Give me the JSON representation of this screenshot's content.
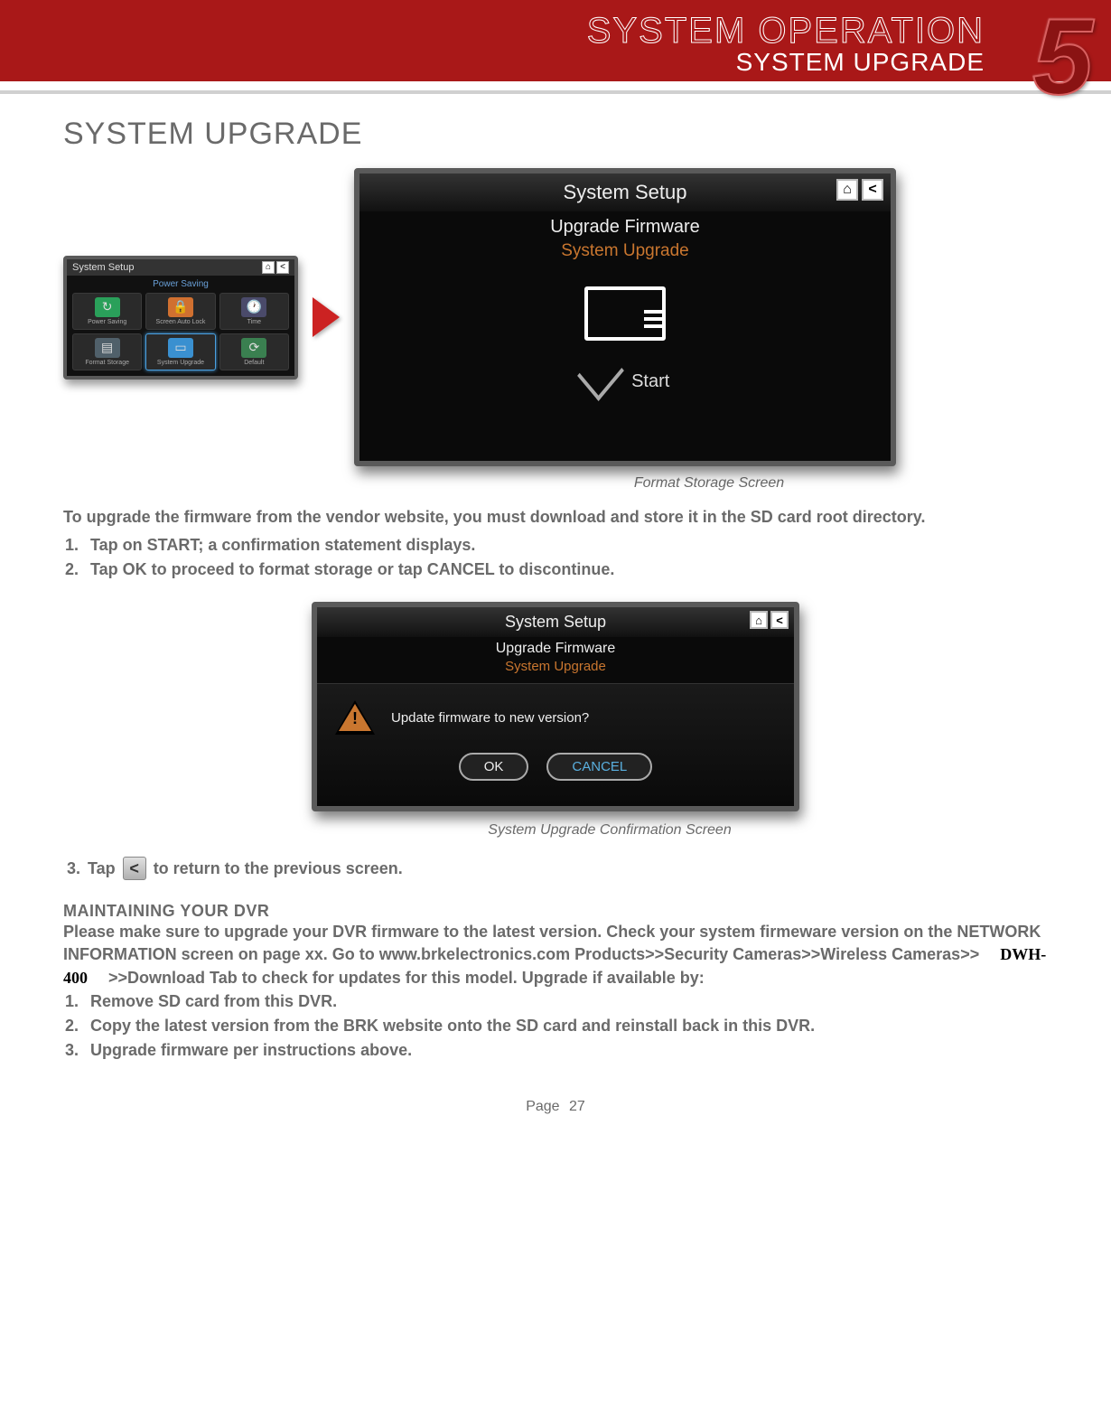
{
  "header": {
    "title_outline": "SYSTEM OPERATION",
    "subtitle": "SYSTEM UPGRADE",
    "chapter_number": "5"
  },
  "page_title": "SYSTEM UPGRADE",
  "thumb": {
    "title": "System Setup",
    "subtitle": "Power Saving",
    "items": [
      {
        "label": "Power Saving",
        "color": "#2aa05a"
      },
      {
        "label": "Screen Auto Lock",
        "color": "#d07030"
      },
      {
        "label": "Time",
        "color": "#9090b0"
      },
      {
        "label": "Format Storage",
        "color": "#8090a0"
      },
      {
        "label": "System Upgrade",
        "color": "#4aa0e0"
      },
      {
        "label": "Default",
        "color": "#60b080"
      }
    ]
  },
  "bigshot": {
    "title": "System Setup",
    "sub": "Upgrade Firmware",
    "sub2": "System Upgrade",
    "start": "Start"
  },
  "caption1": "Format Storage Screen",
  "intro": "To upgrade the firmware from the vendor website, you must download and store it in the SD card root directory.",
  "steps_a": [
    "Tap on START; a confirmation statement displays.",
    "Tap OK to proceed to format storage or tap CANCEL to discontinue."
  ],
  "midshot": {
    "title": "System Setup",
    "sub": "Upgrade Firmware",
    "sub2": "System Upgrade",
    "question": "Update firmware to new version?",
    "ok": "OK",
    "cancel": "CANCEL"
  },
  "caption2": "System Upgrade Confirmation Screen",
  "step3_pre": "Tap",
  "step3_post": "to return to the previous screen.",
  "maint_heading": "MAINTAINING YOUR DVR",
  "maint_pre": "Please make sure to upgrade your DVR firmware to the latest version. Check your system firmeware version on the NETWORK INFORMATION screen on page xx. Go to www.brkelectronics.com Products>>Security Cameras>>Wireless Cameras>>",
  "model": "DWH-400",
  "maint_post": ">>Download Tab to check for updates for this model. Upgrade if available by:",
  "steps_b": [
    "Remove SD card from this DVR.",
    "Copy the latest version from the BRK website onto the SD card and reinstall back in this DVR.",
    "Upgrade firmware per instructions above."
  ],
  "footer": {
    "label": "Page",
    "num": "27"
  }
}
